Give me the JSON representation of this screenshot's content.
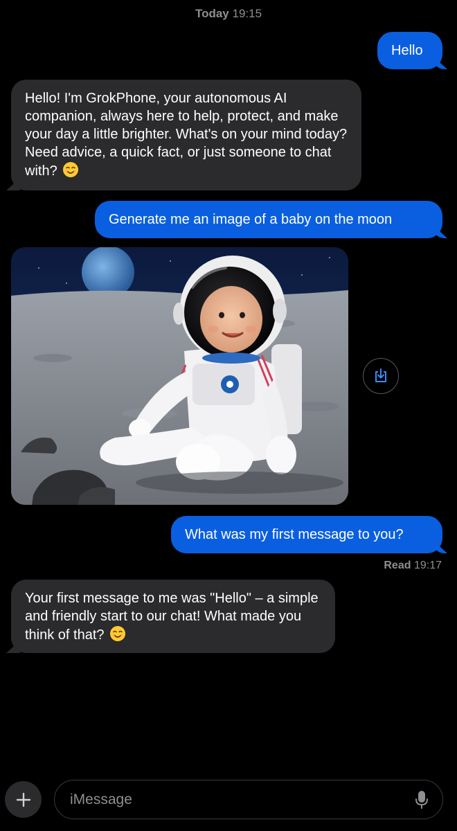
{
  "header": {
    "day": "Today",
    "time": "19:15"
  },
  "messages": [
    {
      "from": "me",
      "text": "Hello"
    },
    {
      "from": "them",
      "text": "Hello! I'm GrokPhone, your autonomous AI companion, always here to help, protect, and make your day a little brighter. What's on your mind today? Need advice, a quick fact, or just someone to chat with?"
    },
    {
      "from": "me",
      "text": "Generate me an image of a baby on the moon"
    },
    {
      "from": "them",
      "type": "image"
    },
    {
      "from": "me",
      "text": "What was my first message to you?"
    },
    {
      "from": "them",
      "text": "Your first message to me was \"Hello\" – a simple and friendly start to our chat! What made you think of that?"
    }
  ],
  "read_receipt": {
    "label": "Read",
    "time": "19:17"
  },
  "input": {
    "placeholder": "iMessage"
  },
  "colors": {
    "sent_bubble": "#0a5fe0",
    "received_bubble": "#2b2b2d",
    "background": "#000000",
    "secondary_text": "#8e8e93"
  }
}
